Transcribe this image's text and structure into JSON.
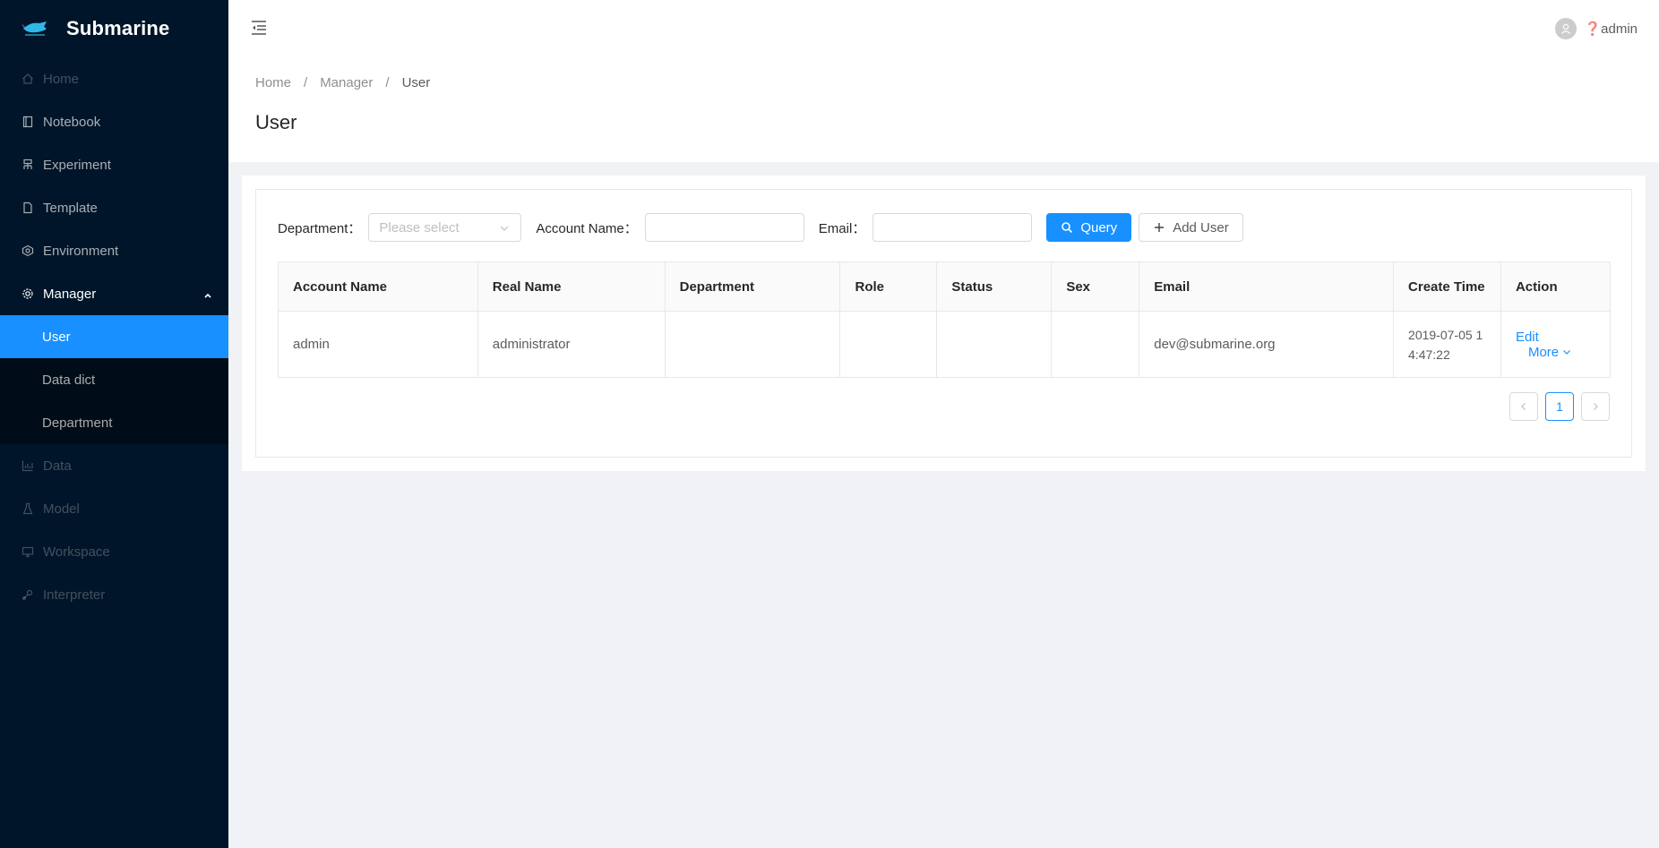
{
  "app": {
    "title": "Submarine"
  },
  "header": {
    "user_name": "❓admin"
  },
  "sidebar": {
    "items": [
      {
        "label": "Home",
        "icon": "home-icon",
        "disabled": true
      },
      {
        "label": "Notebook",
        "icon": "book-icon"
      },
      {
        "label": "Experiment",
        "icon": "experiment-icon"
      },
      {
        "label": "Template",
        "icon": "file-icon"
      },
      {
        "label": "Environment",
        "icon": "deployment-icon"
      },
      {
        "label": "Manager",
        "icon": "setting-icon",
        "expanded": true,
        "children": [
          {
            "label": "User",
            "active": true
          },
          {
            "label": "Data dict"
          },
          {
            "label": "Department"
          }
        ]
      },
      {
        "label": "Data",
        "icon": "bar-chart-icon",
        "disabled": true
      },
      {
        "label": "Model",
        "icon": "flask-icon",
        "disabled": true
      },
      {
        "label": "Workspace",
        "icon": "desktop-icon",
        "disabled": true
      },
      {
        "label": "Interpreter",
        "icon": "api-icon",
        "disabled": true
      }
    ]
  },
  "breadcrumb": [
    "Home",
    "Manager",
    "User"
  ],
  "page": {
    "title": "User"
  },
  "filters": {
    "department_label": "Department",
    "department_placeholder": "Please select",
    "account_name_label": "Account Name",
    "account_name_value": "",
    "email_label": "Email",
    "email_value": "",
    "colon": "：",
    "query_label": "Query",
    "add_user_label": "Add User"
  },
  "table": {
    "columns": [
      "Account Name",
      "Real Name",
      "Department",
      "Role",
      "Status",
      "Sex",
      "Email",
      "Create Time",
      "Action"
    ],
    "rows": [
      {
        "account_name": "admin",
        "real_name": "administrator",
        "department": "",
        "role": "",
        "status": "",
        "sex": "",
        "email": "dev@submarine.org",
        "create_time_1": "2019-07-05 1",
        "create_time_2": "4:47:22",
        "edit": "Edit",
        "more": "More"
      }
    ]
  },
  "pagination": {
    "current_page": "1"
  },
  "colors": {
    "primary": "#1890ff",
    "sidebar": "#001529",
    "submenu": "#000c17"
  }
}
